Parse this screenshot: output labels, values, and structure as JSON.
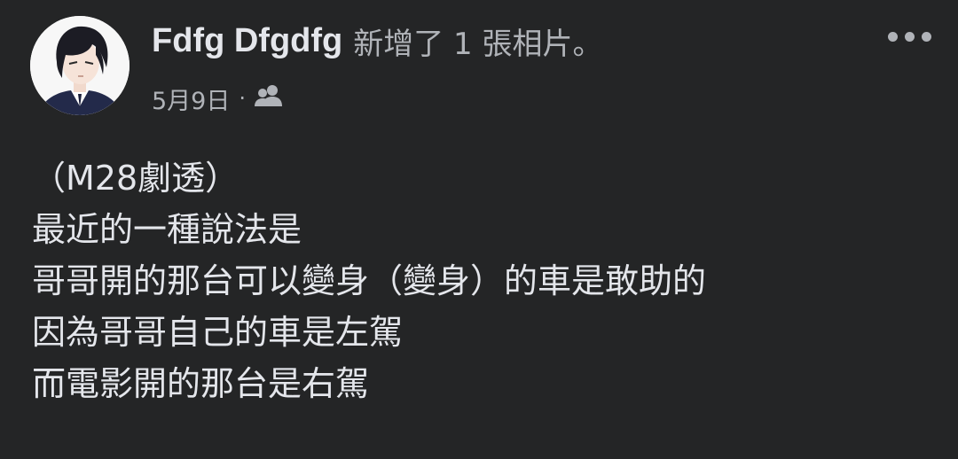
{
  "post": {
    "author_name": "Fdfg Dfgdfg",
    "action_text": "新增了 1 張相片。",
    "date": "5月9日",
    "separator": "·",
    "audience_icon": "friends-icon",
    "more_icon": "more-horizontal-icon",
    "avatar_icon": "profile-avatar-icon",
    "text_lines": [
      "（M28劇透）",
      "最近的一種說法是",
      "哥哥開的那台可以變身（變身）的車是敢助的",
      "因為哥哥自己的車是左駕",
      "而電影開的那台是右駕"
    ]
  },
  "colors": {
    "background": "#242526",
    "primary_text": "#e4e6eb",
    "secondary_text": "#b0b3b8"
  }
}
